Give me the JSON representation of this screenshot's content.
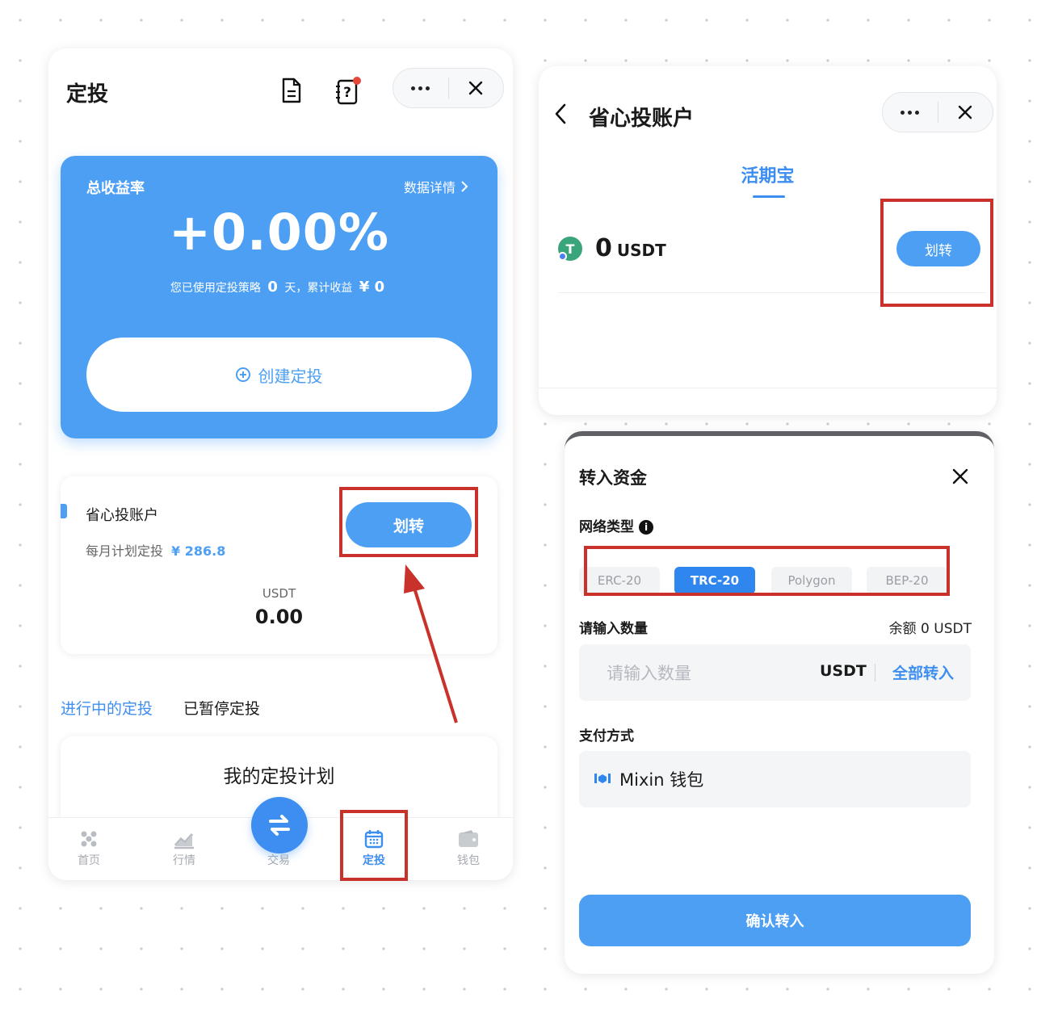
{
  "left": {
    "title": "定投",
    "icons": {
      "doc": "document-icon",
      "help": "help-icon",
      "more": "more-icon",
      "close": "close-icon"
    },
    "summary": {
      "label": "总收益率",
      "detail_link": "数据详情",
      "rate": "+0.00%",
      "sub_prefix": "您已使用定投策略",
      "days": "0",
      "sub_mid": "天，累计收益",
      "earnings": "¥ 0",
      "create_button": "创建定投"
    },
    "account": {
      "name": "省心投账户",
      "plan_label": "每月计划定投",
      "plan_amount": "¥ 286.8",
      "transfer_button": "划转",
      "unit": "USDT",
      "amount": "0.00"
    },
    "tabs": [
      "进行中的定投",
      "已暂停定投"
    ],
    "plan_title": "我的定投计划",
    "nav": [
      "首页",
      "行情",
      "交易",
      "定投",
      "钱包"
    ],
    "active_nav": "定投"
  },
  "right_top": {
    "title": "省心投账户",
    "tab": "活期宝",
    "coin_letter": "T",
    "amount": "0",
    "unit": "USDT",
    "transfer_button": "划转"
  },
  "right_bottom": {
    "title": "转入资金",
    "network_label": "网络类型",
    "info_glyph": "i",
    "networks": [
      "ERC-20",
      "TRC-20",
      "Polygon",
      "BEP-20"
    ],
    "selected_network": "TRC-20",
    "amount_label": "请输入数量",
    "balance": "余额 0 USDT",
    "amount_placeholder": "请输入数量",
    "amount_unit": "USDT",
    "all_in": "全部转入",
    "pay_label": "支付方式",
    "pay_method": "Mixin 钱包",
    "confirm_button": "确认转入"
  },
  "colors": {
    "accent": "#4d9ff3",
    "highlight": "#c8322a"
  }
}
